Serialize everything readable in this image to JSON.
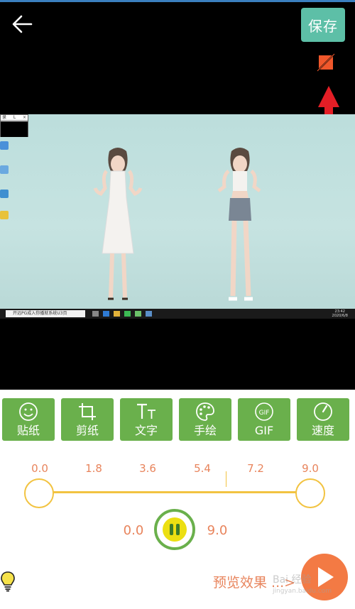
{
  "header": {
    "back_icon": "arrow-left-icon",
    "save_label": "保存"
  },
  "preview": {
    "no_crop_icon": "no-crop-icon",
    "mini_window": {
      "title": "录",
      "buttons": [
        "L",
        "×"
      ]
    },
    "taskbar": {
      "search_text": "开远PG成入你播就系统U3页",
      "clock_time": "23:42",
      "clock_date": "2020/6/8"
    }
  },
  "toolbar": {
    "items": [
      {
        "label": "贴纸",
        "icon": "smiley-icon"
      },
      {
        "label": "剪纸",
        "icon": "crop-icon"
      },
      {
        "label": "文字",
        "icon": "text-size-icon"
      },
      {
        "label": "手绘",
        "icon": "palette-icon"
      },
      {
        "label": "GIF",
        "icon": "gif-icon"
      },
      {
        "label": "速度",
        "icon": "speed-gauge-icon"
      }
    ]
  },
  "timeline": {
    "ticks": [
      "0.0",
      "1.8",
      "3.6",
      "5.4",
      "7.2",
      "9.0"
    ],
    "range_start": "0.0",
    "range_end": "9.0",
    "playhead_position": 0.69,
    "accent": "#f2c341"
  },
  "controls": {
    "pause_icon": "pause-icon",
    "preview_label": "预览效果 ...>",
    "play_icon": "play-icon",
    "hint_icon": "lightbulb-icon"
  },
  "watermark": {
    "text": "Bai 经验",
    "sub": "jingyan.baidu.com"
  },
  "colors": {
    "save_button": "#5dbfa7",
    "tool_green": "#6ab04c",
    "label_orange": "#e8845c",
    "play_orange": "#f37a44",
    "arrow_red": "#e41e26"
  }
}
